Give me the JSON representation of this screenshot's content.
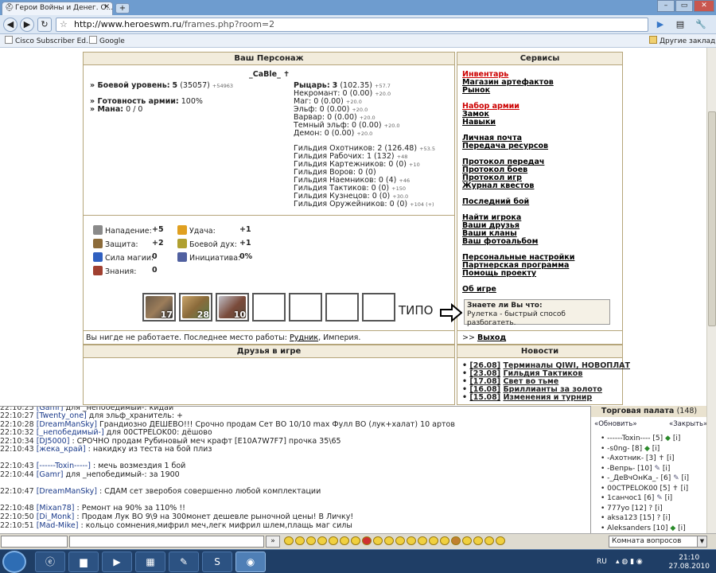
{
  "browser": {
    "tab_title": "Герои Войны и Денег. О...",
    "url_host": "http://www.heroeswm.ru",
    "url_path": "/frames.php?room=2",
    "bookmarks": [
      "Cisco Subscriber Ed...",
      "Google"
    ],
    "other_bookmarks": "Другие закладки"
  },
  "character": {
    "header": "Ваш Персонаж",
    "name": "_CaBle_",
    "combat_level_label": "» Боевой уровень:",
    "combat_level": "5",
    "combat_exp": "(35057)",
    "combat_exp_delta": "+54963",
    "army_label": "» Готовность армии:",
    "army_value": "100%",
    "mana_label": "» Мана:",
    "mana_value": "0 / 0",
    "factions": [
      {
        "label": "Рыцарь:",
        "value": "3",
        "extra": "(102.35)",
        "small": "+57.7"
      },
      {
        "label": "Некромант:",
        "value": "0 (0.00)",
        "small": "+20.0"
      },
      {
        "label": "Маг:",
        "value": "0 (0.00)",
        "small": "+20.0"
      },
      {
        "label": "Эльф:",
        "value": "0 (0.00)",
        "small": "+20.0"
      },
      {
        "label": "Варвар:",
        "value": "0 (0.00)",
        "small": "+20.0"
      },
      {
        "label": "Темный эльф:",
        "value": "0 (0.00)",
        "small": "+20.0"
      },
      {
        "label": "Демон:",
        "value": "0 (0.00)",
        "small": "+20.0"
      }
    ],
    "guilds": [
      {
        "label": "Гильдия Охотников:",
        "value": "2 (126.48)",
        "small": "+53.5"
      },
      {
        "label": "Гильдия Рабочих:",
        "value": "1 (132)",
        "small": "+48"
      },
      {
        "label": "Гильдия Картежников:",
        "value": "0 (0)",
        "small": "+10"
      },
      {
        "label": "Гильдия Воров:",
        "value": "0 (0)",
        "small": ""
      },
      {
        "label": "Гильдия Наемников:",
        "value": "0 (4)",
        "small": "+46"
      },
      {
        "label": "Гильдия Тактиков:",
        "value": "0 (0)",
        "small": "+150"
      },
      {
        "label": "Гильдия Кузнецов:",
        "value": "0 (0)",
        "small": "+30.0"
      },
      {
        "label": "Гильдия Оружейников:",
        "value": "0 (0)",
        "small": "+104 (+)"
      }
    ],
    "stats_left": [
      {
        "label": "Нападение:",
        "value": "+5",
        "icon": "sword-icon",
        "color": "#8a8a8a"
      },
      {
        "label": "Защита:",
        "value": "+2",
        "icon": "shield-icon",
        "color": "#8c6b3a"
      },
      {
        "label": "Сила магии:",
        "value": "0",
        "icon": "wand-icon",
        "color": "#3060c0"
      },
      {
        "label": "Знания:",
        "value": "0",
        "icon": "book-icon",
        "color": "#a04030"
      }
    ],
    "stats_right": [
      {
        "label": "Удача:",
        "value": "+1",
        "icon": "rainbow-icon",
        "color": "#e0a020"
      },
      {
        "label": "Боевой дух:",
        "value": "+1",
        "icon": "wings-icon",
        "color": "#b0a030"
      },
      {
        "label": "Инициатива:",
        "value": "0%",
        "icon": "potion-icon",
        "color": "#5060a0"
      }
    ],
    "army": [
      "17",
      "28",
      "10"
    ],
    "annotation": "ТИПО",
    "work_status": "Вы нигде не работаете. Последнее место работы:",
    "work_place": "Рудник",
    "work_place_rest": ", Империя."
  },
  "services": {
    "header": "Сервисы",
    "groups": [
      [
        "Инвентарь",
        "Магазин артефактов",
        "Рынок"
      ],
      [
        "Набор армии",
        "Замок",
        "Навыки"
      ],
      [
        "Личная почта",
        "Передача ресурсов"
      ],
      [
        "Протокол передач",
        "Протокол боев",
        "Протокол игр",
        "Журнал квестов"
      ],
      [
        "Последний бой"
      ],
      [
        "Найти игрока",
        "Ваши друзья",
        "Ваши кланы",
        "Ваш фотоальбом"
      ],
      [
        "Персональные настройки",
        "Партнерская программа",
        "Помощь проекту"
      ],
      [
        "Об игре"
      ]
    ],
    "tip_title": "Знаете ли Вы что:",
    "tip_text": "Рулетка - быстрый способ разбогатеть.",
    "exit_prefix": ">>",
    "exit": "Выход"
  },
  "friends": {
    "header": "Друзья в игре"
  },
  "news": {
    "header": "Новости",
    "items": [
      {
        "date": "[26.08]",
        "title": "Терминалы QIWI, НОВОПЛАТ"
      },
      {
        "date": "[23.08]",
        "title": "Гильдия Тактиков"
      },
      {
        "date": "[17.08]",
        "title": "Свет во тьме"
      },
      {
        "date": "[16.08]",
        "title": "Бриллианты за золото"
      },
      {
        "date": "[15.08]",
        "title": "Изменения и турнир"
      }
    ]
  },
  "chat": {
    "lines": [
      {
        "time": "22:10:25",
        "nick": "[Gamr]",
        "text": "для _непобедимый-: кидай"
      },
      {
        "time": "22:10:27",
        "nick": "[Twenty_one]",
        "text": "для эльф_хранитель: +"
      },
      {
        "time": "22:10:28",
        "nick": "[DreamManSky]",
        "text": "Грандиозно ДЕШЕВО!!! Срочно продам Сет ВО 10/10 max Фулл ВО (лук+халат) 10 артов"
      },
      {
        "time": "22:10:32",
        "nick": "[_непобедимый-]",
        "text": "для 00CTPELOK00: дёшово"
      },
      {
        "time": "22:10:34",
        "nick": "[DJ5000]",
        "text": ": СРОЧНО продам Рубиновый меч крафт [E10A7W7F7] прочка 35\\65"
      },
      {
        "time": "22:10:43",
        "nick": "[жека_край]",
        "text": ": накидку из теста на бой плиз"
      },
      {
        "time": "22:10:43",
        "nick": "[------Toxin-----]",
        "text": ": мечь возмездия 1 бой"
      },
      {
        "time": "22:10:44",
        "nick": "[Gamr]",
        "text": "для _непобедимый-: за 1900"
      },
      {
        "time": "22:10:47",
        "nick": "[DreamManSky]",
        "text": ": СДАМ сет зверобоя совершенно любой комплектации"
      },
      {
        "time": "22:10:48",
        "nick": "[Mixan78]",
        "text": ": Ремонт на 90% за 110% !!"
      },
      {
        "time": "22:10:50",
        "nick": "[Di_Monk]",
        "text": ": Продам Лук ВО 9\\9 на 300монет дешевле рыночной цены! В Личку!"
      },
      {
        "time": "22:10:51",
        "nick": "[Mad-Mike]",
        "text": ": кольцо сомнения,мифрил меч,легк мифрил шлем,плащь маг силы"
      }
    ]
  },
  "trade": {
    "title": "Торговая палата",
    "count": "(148)",
    "refresh": "«Обновить»",
    "close": "«Закрыть»",
    "users": [
      "------Toxin---- [5]",
      "-s0ng- [8]",
      "-Ахотник- [3]",
      "-Вепрь- [10]",
      "-_ДеВчОнКа_- [6]",
      "00CTPELOK00 [5]",
      "1санчос1 [6]",
      "777yo [12]",
      "aksa123 [15]",
      "Aleksanders [10]"
    ],
    "info": "[i]"
  },
  "chatbar": {
    "send": "»",
    "room": "Комната вопросов"
  },
  "taskbar": {
    "lang": "RU",
    "time": "21:10",
    "date": "27.08.2010"
  }
}
